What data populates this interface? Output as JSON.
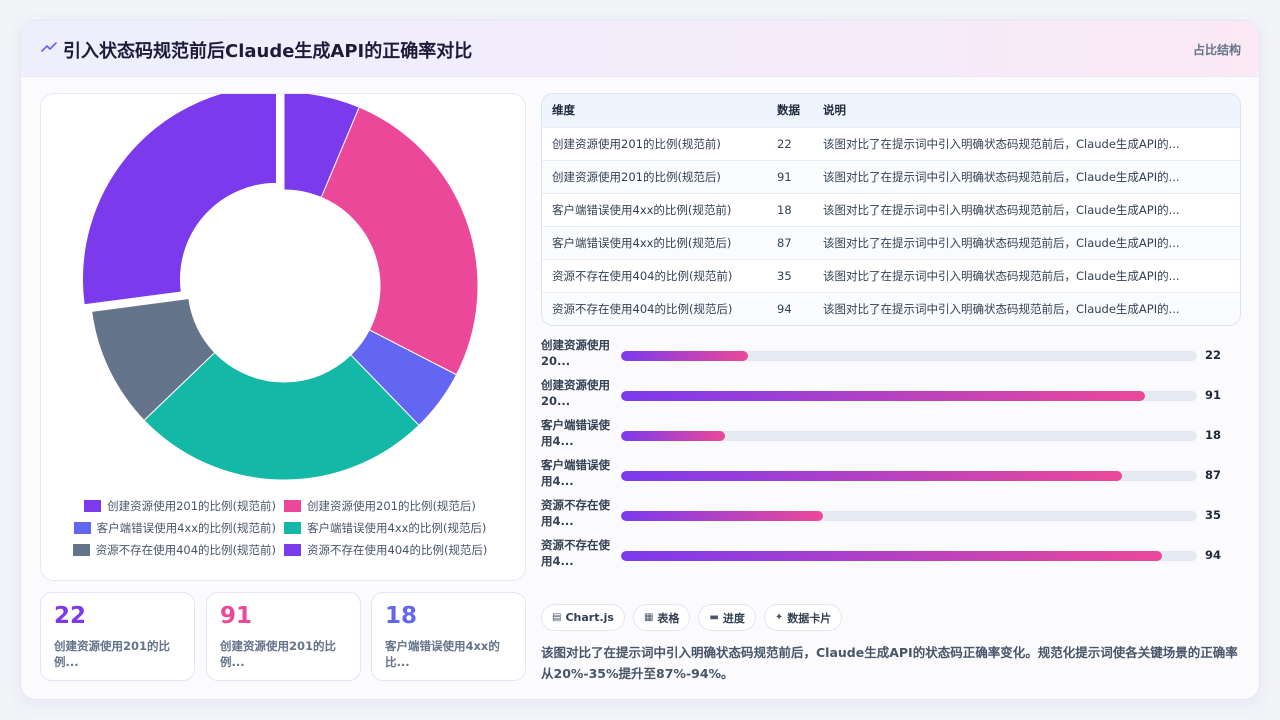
{
  "header": {
    "icon": "trend-line-icon",
    "title": "引入状态码规范前后Claude生成API的正确率对比",
    "tag": "占比结构"
  },
  "colors": {
    "purple": "#7c3aed",
    "pink": "#ec4899",
    "indigo": "#6366f1",
    "teal": "#14b8a6",
    "slate": "#64748b",
    "violet": "#7c3aed"
  },
  "chart_data": {
    "type": "pie",
    "variant": "donut",
    "categories": [
      "创建资源使用201的比例(规范前)",
      "创建资源使用201的比例(规范后)",
      "客户端错误使用4xx的比例(规范前)",
      "客户端错误使用4xx的比例(规范后)",
      "资源不存在使用404的比例(规范前)",
      "资源不存在使用404的比例(规范后)"
    ],
    "values": [
      22,
      91,
      18,
      87,
      35,
      94
    ],
    "colors": [
      "#7c3aed",
      "#ec4899",
      "#6366f1",
      "#14b8a6",
      "#64748b",
      "#7c3aed"
    ],
    "legend_placement": "bottom"
  },
  "table": {
    "headers": [
      "维度",
      "数据",
      "说明"
    ],
    "rows": [
      [
        "创建资源使用201的比例(规范前)",
        "22",
        "该图对比了在提示词中引入明确状态码规范前后，Claude生成API的..."
      ],
      [
        "创建资源使用201的比例(规范后)",
        "91",
        "该图对比了在提示词中引入明确状态码规范前后，Claude生成API的..."
      ],
      [
        "客户端错误使用4xx的比例(规范前)",
        "18",
        "该图对比了在提示词中引入明确状态码规范前后，Claude生成API的..."
      ],
      [
        "客户端错误使用4xx的比例(规范后)",
        "87",
        "该图对比了在提示词中引入明确状态码规范前后，Claude生成API的..."
      ],
      [
        "资源不存在使用404的比例(规范前)",
        "35",
        "该图对比了在提示词中引入明确状态码规范前后，Claude生成API的..."
      ],
      [
        "资源不存在使用404的比例(规范后)",
        "94",
        "该图对比了在提示词中引入明确状态码规范前后，Claude生成API的..."
      ]
    ]
  },
  "progress": {
    "max": 100,
    "items": [
      {
        "label": "创建资源使用20...",
        "value": 22
      },
      {
        "label": "创建资源使用20...",
        "value": 91
      },
      {
        "label": "客户端错误使用4...",
        "value": 18
      },
      {
        "label": "客户端错误使用4...",
        "value": 87
      },
      {
        "label": "资源不存在使用4...",
        "value": 35
      },
      {
        "label": "资源不存在使用4...",
        "value": 94
      }
    ]
  },
  "stats": [
    {
      "value": "22",
      "label": "创建资源使用201的比例...",
      "color": "#7c3aed"
    },
    {
      "value": "91",
      "label": "创建资源使用201的比例...",
      "color": "#ec4899"
    },
    {
      "value": "18",
      "label": "客户端错误使用4xx的比...",
      "color": "#6366f1"
    }
  ],
  "chips": [
    {
      "icon": "chart-icon",
      "glyph": "▤",
      "label": "Chart.js"
    },
    {
      "icon": "table-icon",
      "glyph": "▦",
      "label": "表格"
    },
    {
      "icon": "progress-icon",
      "glyph": "▬",
      "label": "进度"
    },
    {
      "icon": "sparkle-icon",
      "glyph": "✦",
      "label": "数据卡片"
    }
  ],
  "description": "该图对比了在提示词中引入明确状态码规范前后，Claude生成API的状态码正确率变化。规范化提示词使各关键场景的正确率从20%-35%提升至87%-94%。"
}
